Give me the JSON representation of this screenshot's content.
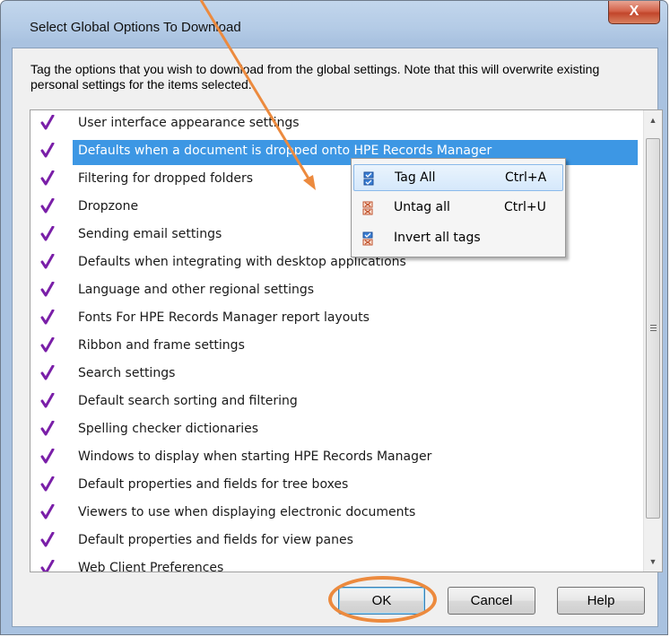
{
  "window": {
    "title": "Select Global Options To Download",
    "close_label": "X"
  },
  "description": "Tag the options that you wish to download from the global settings. Note that this will overwrite existing personal settings for the items selected.",
  "list": {
    "items": [
      {
        "label": "User interface appearance settings",
        "tagged": true,
        "selected": false
      },
      {
        "label": "Defaults when a document is dropped onto HPE Records Manager",
        "tagged": true,
        "selected": true
      },
      {
        "label": "Filtering for dropped folders",
        "tagged": true,
        "selected": false
      },
      {
        "label": "Dropzone",
        "tagged": true,
        "selected": false
      },
      {
        "label": "Sending email settings",
        "tagged": true,
        "selected": false
      },
      {
        "label": "Defaults when integrating with desktop applications",
        "tagged": true,
        "selected": false
      },
      {
        "label": "Language and other regional settings",
        "tagged": true,
        "selected": false
      },
      {
        "label": "Fonts For HPE Records Manager report layouts",
        "tagged": true,
        "selected": false
      },
      {
        "label": "Ribbon and frame settings",
        "tagged": true,
        "selected": false
      },
      {
        "label": "Search settings",
        "tagged": true,
        "selected": false
      },
      {
        "label": "Default search sorting and filtering",
        "tagged": true,
        "selected": false
      },
      {
        "label": "Spelling checker dictionaries",
        "tagged": true,
        "selected": false
      },
      {
        "label": "Windows to display when starting HPE Records Manager",
        "tagged": true,
        "selected": false
      },
      {
        "label": "Default properties and fields for tree boxes",
        "tagged": true,
        "selected": false
      },
      {
        "label": "Viewers to use when displaying electronic documents",
        "tagged": true,
        "selected": false
      },
      {
        "label": "Default properties and fields for view panes",
        "tagged": true,
        "selected": false
      },
      {
        "label": "Web Client Preferences",
        "tagged": true,
        "selected": false
      }
    ]
  },
  "context_menu": {
    "items": [
      {
        "label": "Tag All",
        "shortcut": "Ctrl+A",
        "icon": "tag-all-icon"
      },
      {
        "label": "Untag all",
        "shortcut": "Ctrl+U",
        "icon": "untag-all-icon"
      },
      {
        "label": "Invert all tags",
        "shortcut": "",
        "icon": "invert-tags-icon"
      }
    ]
  },
  "buttons": {
    "ok": "OK",
    "cancel": "Cancel",
    "help": "Help"
  },
  "colors": {
    "check": "#7a1fa8",
    "selection": "#3d97e4",
    "annotation": "#ec8a3e"
  }
}
